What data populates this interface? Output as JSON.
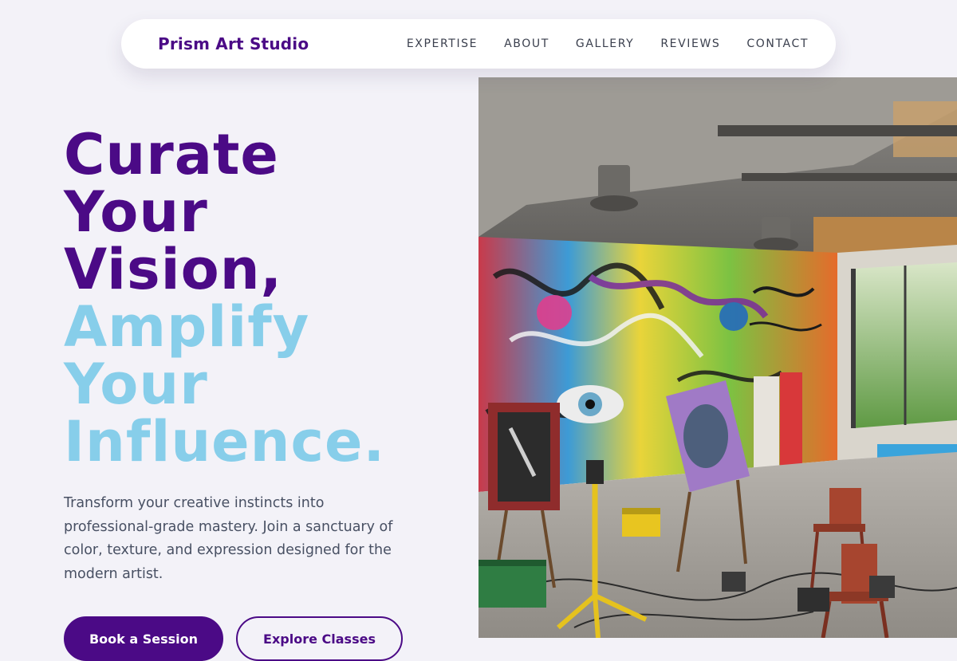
{
  "nav": {
    "brand": "Prism Art Studio",
    "links": [
      {
        "label": "EXPERTISE"
      },
      {
        "label": "ABOUT"
      },
      {
        "label": "GALLERY"
      },
      {
        "label": "REVIEWS"
      },
      {
        "label": "CONTACT"
      }
    ]
  },
  "hero": {
    "headline_lines_dark": [
      "Curate",
      "Your",
      "Vision,"
    ],
    "headline_lines_light": [
      "Amplify",
      "Your",
      "Influence."
    ],
    "description": "Transform your creative instincts into professional-grade mastery. Join a sanctuary of color, texture, and expression designed for the modern artist.",
    "primary_button": "Book a Session",
    "secondary_button": "Explore Classes"
  },
  "colors": {
    "brand": "#4b0a86",
    "accent": "#87ceea",
    "background": "#f3f2f8",
    "body_text": "#485063"
  },
  "icons": {
    "hero_image": "graffiti-art-studio-photo"
  }
}
